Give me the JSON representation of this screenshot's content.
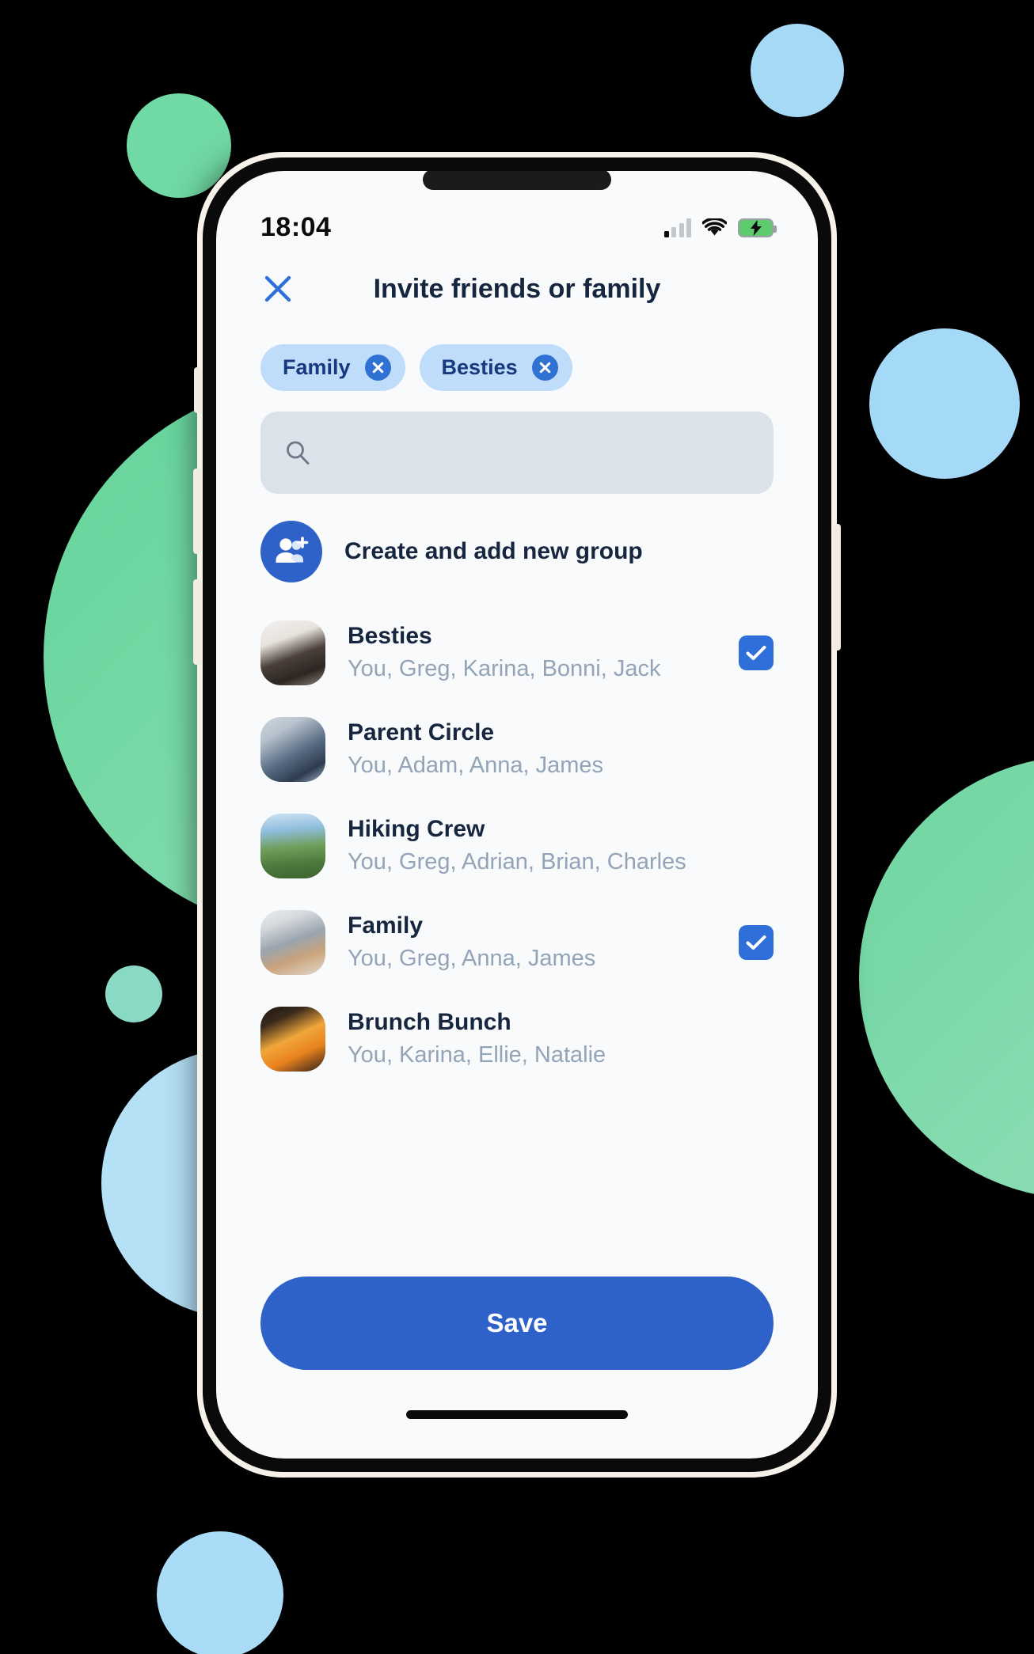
{
  "status_bar": {
    "time": "18:04",
    "signal_icon": "cellular-signal-icon",
    "signal_bars_total": 4,
    "signal_bars_active": 1,
    "wifi_icon": "wifi-icon",
    "battery_icon": "battery-charging-icon",
    "battery_color": "#5ecb6f"
  },
  "header": {
    "title": "Invite friends or family",
    "close_icon": "close-x-icon",
    "close_color": "#2f6fd9"
  },
  "chips": [
    {
      "label": "Family",
      "remove_icon": "circle-close-icon"
    },
    {
      "label": "Besties",
      "remove_icon": "circle-close-icon"
    }
  ],
  "search": {
    "icon": "search-icon",
    "value": "",
    "placeholder": ""
  },
  "create_group": {
    "label": "Create and add new group",
    "icon": "add-people-icon",
    "avatar_color": "#2f62c9"
  },
  "groups": [
    {
      "name": "Besties",
      "members": "You, Greg, Karina, Bonni, Jack",
      "avatar": "group-photo-besties",
      "selected": true
    },
    {
      "name": "Parent Circle",
      "members": "You, Adam, Anna, James",
      "avatar": "group-photo-parent-circle",
      "selected": false
    },
    {
      "name": "Hiking Crew",
      "members": "You, Greg, Adrian, Brian, Charles",
      "avatar": "group-photo-hiking-crew",
      "selected": false
    },
    {
      "name": "Family",
      "members": "You, Greg, Anna, James",
      "avatar": "group-photo-family",
      "selected": true
    },
    {
      "name": "Brunch Bunch",
      "members": "You, Karina, Ellie, Natalie",
      "avatar": "group-photo-brunch-bunch",
      "selected": false
    }
  ],
  "footer": {
    "save_label": "Save"
  },
  "theme": {
    "accent_blue": "#2f62c9",
    "checkbox_blue": "#2f6fd9",
    "chip_bg": "#bfdcfb",
    "chip_text": "#163a7d",
    "title_text": "#16263f",
    "member_text": "#93a3b8",
    "search_bg": "#dce2ea",
    "screen_bg": "#f9fafb",
    "page_bg": "#000000",
    "blob_green": "#6ed5a0",
    "blob_blue": "#a4d9f7"
  }
}
